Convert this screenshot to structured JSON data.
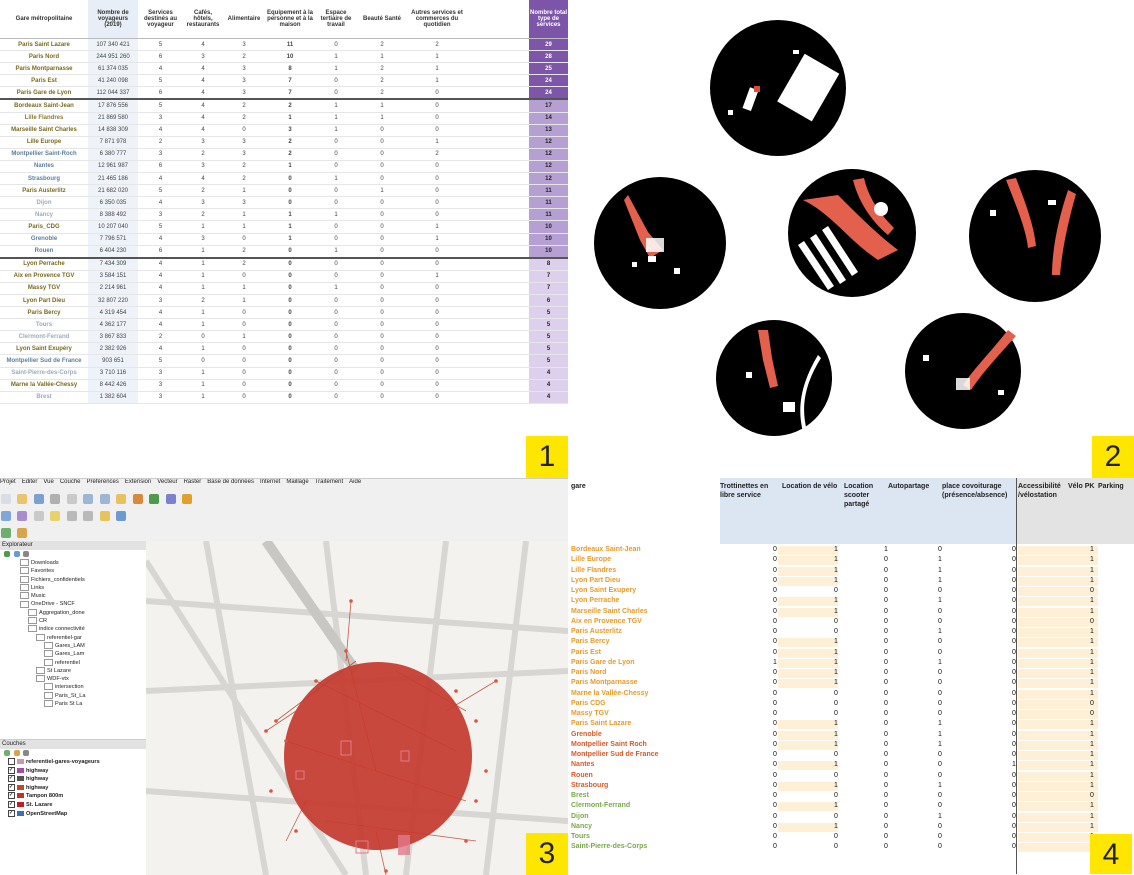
{
  "panel1": {
    "headers": [
      "Gare métropolitaine",
      "Nombre de voyageurs (2019)",
      "Services destinés au voyageur",
      "Cafés, hôtels, restaurants",
      "Alimentaire",
      "Equipement à la personne et à la maison",
      "Espace tertiaire de travail",
      "Beauté Santé",
      "Autres services et commerces du quotidien",
      "Nombre total type de services"
    ],
    "rows": [
      {
        "name": "Paris Saint Lazare",
        "v": "107 340 421",
        "c": [
          "5",
          "4",
          "3",
          "11",
          "0",
          "2",
          "2"
        ],
        "t": "29",
        "g": 1,
        "nc": "#7a6a1e"
      },
      {
        "name": "Paris Nord",
        "v": "244 951 260",
        "c": [
          "6",
          "3",
          "2",
          "10",
          "1",
          "1",
          "1"
        ],
        "t": "28",
        "g": 1,
        "nc": "#7a6a1e"
      },
      {
        "name": "Paris Montparnasse",
        "v": "61 374 035",
        "c": [
          "4",
          "4",
          "3",
          "8",
          "1",
          "2",
          "1"
        ],
        "t": "25",
        "g": 1,
        "nc": "#7a6a1e"
      },
      {
        "name": "Paris Est",
        "v": "41 240 098",
        "c": [
          "5",
          "4",
          "3",
          "7",
          "0",
          "2",
          "1"
        ],
        "t": "24",
        "g": 1,
        "nc": "#7a6a1e"
      },
      {
        "name": "Paris Gare de Lyon",
        "v": "112 044 337",
        "c": [
          "6",
          "4",
          "3",
          "7",
          "0",
          "2",
          "0"
        ],
        "t": "24",
        "g": 1,
        "nc": "#7a6a1e"
      },
      {
        "name": "Bordeaux Saint-Jean",
        "v": "17 876 556",
        "c": [
          "5",
          "4",
          "2",
          "2",
          "1",
          "1",
          "0"
        ],
        "t": "17",
        "g": 2,
        "nc": "#7a6a1e",
        "sep": true
      },
      {
        "name": "Lille Flandres",
        "v": "21 869 580",
        "c": [
          "3",
          "4",
          "2",
          "1",
          "1",
          "1",
          "0"
        ],
        "t": "14",
        "g": 2,
        "nc": "#8a7a30"
      },
      {
        "name": "Marseille Saint Charles",
        "v": "14 838 309",
        "c": [
          "4",
          "4",
          "0",
          "3",
          "1",
          "0",
          "0"
        ],
        "t": "13",
        "g": 2,
        "nc": "#7a6a1e"
      },
      {
        "name": "Lille Europe",
        "v": "7 871 978",
        "c": [
          "2",
          "3",
          "3",
          "2",
          "0",
          "0",
          "1"
        ],
        "t": "12",
        "g": 2,
        "nc": "#7a6a1e"
      },
      {
        "name": "Montpellier Saint-Roch",
        "v": "6 380 777",
        "c": [
          "3",
          "2",
          "3",
          "2",
          "0",
          "0",
          "2"
        ],
        "t": "12",
        "g": 2,
        "nc": "#5a7fa0"
      },
      {
        "name": "Nantes",
        "v": "12 961 987",
        "c": [
          "6",
          "3",
          "2",
          "1",
          "0",
          "0",
          "0"
        ],
        "t": "12",
        "g": 2,
        "nc": "#5a7fa0"
      },
      {
        "name": "Strasbourg",
        "v": "21 465 186",
        "c": [
          "4",
          "4",
          "2",
          "0",
          "1",
          "0",
          "0"
        ],
        "t": "12",
        "g": 2,
        "nc": "#5a7fa0"
      },
      {
        "name": "Paris Austerlitz",
        "v": "21 682 020",
        "c": [
          "5",
          "2",
          "1",
          "0",
          "0",
          "1",
          "0"
        ],
        "t": "11",
        "g": 2,
        "nc": "#7a6a1e"
      },
      {
        "name": "Dijon",
        "v": "6 350 035",
        "c": [
          "4",
          "3",
          "3",
          "0",
          "0",
          "0",
          "0"
        ],
        "t": "11",
        "g": 2,
        "nc": "#9aabbd"
      },
      {
        "name": "Nancy",
        "v": "8 388 492",
        "c": [
          "3",
          "2",
          "1",
          "1",
          "1",
          "0",
          "0"
        ],
        "t": "11",
        "g": 2,
        "nc": "#9aabbd"
      },
      {
        "name": "Paris_CDG",
        "v": "10 207 040",
        "c": [
          "5",
          "1",
          "1",
          "1",
          "0",
          "0",
          "1"
        ],
        "t": "10",
        "g": 2,
        "nc": "#7a6a1e"
      },
      {
        "name": "Grenoble",
        "v": "7 796 571",
        "c": [
          "4",
          "3",
          "0",
          "1",
          "0",
          "0",
          "1"
        ],
        "t": "10",
        "g": 2,
        "nc": "#5a7fa0"
      },
      {
        "name": "Rouen",
        "v": "6 404 230",
        "c": [
          "6",
          "1",
          "2",
          "0",
          "1",
          "0",
          "0"
        ],
        "t": "10",
        "g": 2,
        "nc": "#5a7fa0"
      },
      {
        "name": "Lyon Perrache",
        "v": "7 434 309",
        "c": [
          "4",
          "1",
          "2",
          "0",
          "0",
          "0",
          "0"
        ],
        "t": "8",
        "g": 3,
        "nc": "#7a6a1e",
        "sep": true
      },
      {
        "name": "Aix en Provence TGV",
        "v": "3 584 151",
        "c": [
          "4",
          "1",
          "0",
          "0",
          "0",
          "0",
          "1"
        ],
        "t": "7",
        "g": 3,
        "nc": "#7a6a1e"
      },
      {
        "name": "Massy TGV",
        "v": "2 214 961",
        "c": [
          "4",
          "1",
          "1",
          "0",
          "1",
          "0",
          "0"
        ],
        "t": "7",
        "g": 3,
        "nc": "#7a6a1e"
      },
      {
        "name": "Lyon Part Dieu",
        "v": "32 807 220",
        "c": [
          "3",
          "2",
          "1",
          "0",
          "0",
          "0",
          "0"
        ],
        "t": "6",
        "g": 3,
        "nc": "#7a6a1e"
      },
      {
        "name": "Paris Bercy",
        "v": "4 319 454",
        "c": [
          "4",
          "1",
          "0",
          "0",
          "0",
          "0",
          "0"
        ],
        "t": "5",
        "g": 3,
        "nc": "#7a6a1e"
      },
      {
        "name": "Tours",
        "v": "4 362 177",
        "c": [
          "4",
          "1",
          "0",
          "0",
          "0",
          "0",
          "0"
        ],
        "t": "5",
        "g": 3,
        "nc": "#9aabbd"
      },
      {
        "name": "Clermont-Ferrand",
        "v": "3 867 833",
        "c": [
          "2",
          "0",
          "1",
          "0",
          "0",
          "0",
          "0"
        ],
        "t": "5",
        "g": 3,
        "nc": "#9aabbd"
      },
      {
        "name": "Lyon Saint Exupéry",
        "v": "2 382 926",
        "c": [
          "4",
          "1",
          "0",
          "0",
          "0",
          "0",
          "0"
        ],
        "t": "5",
        "g": 3,
        "nc": "#7a6a1e"
      },
      {
        "name": "Montpellier Sud de France",
        "v": "903 651",
        "c": [
          "5",
          "0",
          "0",
          "0",
          "0",
          "0",
          "0"
        ],
        "t": "5",
        "g": 3,
        "nc": "#5a7fa0"
      },
      {
        "name": "Saint-Pierre-des-Corps",
        "v": "3 710 116",
        "c": [
          "3",
          "1",
          "0",
          "0",
          "0",
          "0",
          "0"
        ],
        "t": "4",
        "g": 3,
        "nc": "#9aabbd"
      },
      {
        "name": "Marne la Vallée-Chessy",
        "v": "8 442 426",
        "c": [
          "3",
          "1",
          "0",
          "0",
          "0",
          "0",
          "0"
        ],
        "t": "4",
        "g": 3,
        "nc": "#7a6a1e"
      },
      {
        "name": "Brest",
        "v": "1 382 604",
        "c": [
          "3",
          "1",
          "0",
          "0",
          "0",
          "0",
          "0"
        ],
        "t": "4",
        "g": 3,
        "nc": "#9aabbd"
      }
    ],
    "badge": "1"
  },
  "panel2": {
    "badge": "2"
  },
  "panel3": {
    "menu": [
      "Projet",
      "Editer",
      "Vue",
      "Couche",
      "Préférences",
      "Extension",
      "Vecteur",
      "Raster",
      "Base de données",
      "Internet",
      "Maillage",
      "Traitement",
      "Aide"
    ],
    "explorer_title": "Explorateur",
    "explorer_items": [
      {
        "label": "Downloads",
        "indent": 20
      },
      {
        "label": "Favorites",
        "indent": 20
      },
      {
        "label": "Fichiers_confidentiels",
        "indent": 20
      },
      {
        "label": "Links",
        "indent": 20
      },
      {
        "label": "Music",
        "indent": 20
      },
      {
        "label": "OneDrive - SNCF",
        "indent": 20
      },
      {
        "label": "Aggregation_done",
        "indent": 28
      },
      {
        "label": "CR",
        "indent": 28
      },
      {
        "label": "indice connectivité",
        "indent": 28
      },
      {
        "label": "referentiel-gar",
        "indent": 36
      },
      {
        "label": "Gares_LAM",
        "indent": 44
      },
      {
        "label": "Gares_Lam",
        "indent": 44
      },
      {
        "label": "referentiel",
        "indent": 44
      },
      {
        "label": "St Lazare",
        "indent": 36
      },
      {
        "label": "WDF-vtx",
        "indent": 36
      },
      {
        "label": "intersection",
        "indent": 44
      },
      {
        "label": "Paris_St_La",
        "indent": 44
      },
      {
        "label": "Paris St La",
        "indent": 44
      }
    ],
    "layers_title": "Couches",
    "layers": [
      {
        "label": "referentiel-gares-voyageurs",
        "color": "#c9a",
        "checked": false
      },
      {
        "label": "highway",
        "color": "#a64ca6",
        "checked": true
      },
      {
        "label": "highway",
        "color": "#555",
        "checked": true
      },
      {
        "label": "highway",
        "color": "#c04a2a",
        "checked": true
      },
      {
        "label": "Tampon 800m",
        "color": "#c0322a",
        "checked": true
      },
      {
        "label": "St. Lazare",
        "color": "#c02020",
        "checked": true
      },
      {
        "label": "OpenStreetMap",
        "color": "#3a70c0",
        "checked": true
      }
    ],
    "badge": "3"
  },
  "panel4": {
    "headers": [
      "gare",
      "Trottinettes en libre service",
      "Location de vélo",
      "Location scooter partagé",
      "Autopartage",
      "place covoiturage (présence/absence)",
      "Accessibilité /vélostation",
      "Vélo PK",
      "Parking"
    ],
    "rows": [
      {
        "name": "Bordeaux Saint-Jean",
        "c": "#e89a2a",
        "v": [
          "0",
          "1",
          "1",
          "0",
          "0",
          "1"
        ]
      },
      {
        "name": "Lille Europe",
        "c": "#e89a2a",
        "v": [
          "0",
          "1",
          "0",
          "1",
          "0",
          "1"
        ]
      },
      {
        "name": "Lille Flandres",
        "c": "#e89a2a",
        "v": [
          "0",
          "1",
          "0",
          "1",
          "0",
          "1"
        ]
      },
      {
        "name": "Lyon Part Dieu",
        "c": "#e89a2a",
        "v": [
          "0",
          "1",
          "0",
          "1",
          "0",
          "1"
        ]
      },
      {
        "name": "Lyon Saint Exupery",
        "c": "#e89a2a",
        "v": [
          "0",
          "0",
          "0",
          "0",
          "0",
          "0"
        ]
      },
      {
        "name": "Lyon Perrache",
        "c": "#e89a2a",
        "v": [
          "0",
          "1",
          "0",
          "1",
          "0",
          "1"
        ]
      },
      {
        "name": "Marseille Saint Charles",
        "c": "#e89a2a",
        "v": [
          "0",
          "1",
          "0",
          "0",
          "0",
          "1"
        ]
      },
      {
        "name": "Aix en Provence TGV",
        "c": "#e89a2a",
        "v": [
          "0",
          "0",
          "0",
          "0",
          "0",
          "0"
        ]
      },
      {
        "name": "Paris Austerlitz",
        "c": "#e89a2a",
        "v": [
          "0",
          "0",
          "0",
          "1",
          "0",
          "1"
        ]
      },
      {
        "name": "Paris Bercy",
        "c": "#e89a2a",
        "v": [
          "0",
          "1",
          "0",
          "0",
          "0",
          "1"
        ]
      },
      {
        "name": "Paris Est",
        "c": "#e89a2a",
        "v": [
          "0",
          "1",
          "0",
          "0",
          "0",
          "1"
        ]
      },
      {
        "name": "Paris Gare de Lyon",
        "c": "#e89a2a",
        "v": [
          "1",
          "1",
          "0",
          "1",
          "0",
          "1"
        ]
      },
      {
        "name": "Paris Nord",
        "c": "#e89a2a",
        "v": [
          "0",
          "1",
          "0",
          "0",
          "0",
          "1"
        ]
      },
      {
        "name": "Paris Montparnasse",
        "c": "#e89a2a",
        "v": [
          "0",
          "1",
          "0",
          "0",
          "0",
          "1"
        ]
      },
      {
        "name": "Marne la Vallée-Chessy",
        "c": "#e89a2a",
        "v": [
          "0",
          "0",
          "0",
          "0",
          "0",
          "1"
        ]
      },
      {
        "name": "Paris CDG",
        "c": "#e89a2a",
        "v": [
          "0",
          "0",
          "0",
          "0",
          "0",
          "0"
        ]
      },
      {
        "name": "Massy TGV",
        "c": "#e89a2a",
        "v": [
          "0",
          "0",
          "0",
          "0",
          "0",
          "0"
        ]
      },
      {
        "name": "Paris Saint Lazare",
        "c": "#e89a2a",
        "v": [
          "0",
          "1",
          "0",
          "1",
          "0",
          "1"
        ]
      },
      {
        "name": "Grenoble",
        "c": "#d45a2a",
        "v": [
          "0",
          "1",
          "0",
          "1",
          "0",
          "1"
        ]
      },
      {
        "name": "Montpellier Saint Roch",
        "c": "#d45a2a",
        "v": [
          "0",
          "1",
          "0",
          "1",
          "0",
          "1"
        ]
      },
      {
        "name": "Montpellier Sud de France",
        "c": "#d45a2a",
        "v": [
          "0",
          "0",
          "0",
          "0",
          "0",
          "1"
        ]
      },
      {
        "name": "Nantes",
        "c": "#d45a2a",
        "v": [
          "0",
          "1",
          "0",
          "0",
          "1",
          "1"
        ]
      },
      {
        "name": "Rouen",
        "c": "#d45a2a",
        "v": [
          "0",
          "0",
          "0",
          "0",
          "0",
          "1"
        ]
      },
      {
        "name": "Strasbourg",
        "c": "#d45a2a",
        "v": [
          "0",
          "1",
          "0",
          "1",
          "0",
          "1"
        ]
      },
      {
        "name": "Brest",
        "c": "#7aa84a",
        "v": [
          "0",
          "0",
          "0",
          "0",
          "0",
          "0"
        ]
      },
      {
        "name": "Clermont-Ferrand",
        "c": "#7aa84a",
        "v": [
          "0",
          "1",
          "0",
          "0",
          "0",
          "1"
        ]
      },
      {
        "name": "Dijon",
        "c": "#7aa84a",
        "v": [
          "0",
          "0",
          "0",
          "1",
          "0",
          "1"
        ]
      },
      {
        "name": "Nancy",
        "c": "#7aa84a",
        "v": [
          "0",
          "1",
          "0",
          "0",
          "0",
          "1"
        ]
      },
      {
        "name": "Tours",
        "c": "#7aa84a",
        "v": [
          "0",
          "0",
          "0",
          "0",
          "0",
          "1"
        ]
      },
      {
        "name": "Saint-Pierre-des-Corps",
        "c": "#7aa84a",
        "v": [
          "0",
          "0",
          "0",
          "0",
          "0",
          "1"
        ]
      }
    ],
    "badge": "4"
  }
}
